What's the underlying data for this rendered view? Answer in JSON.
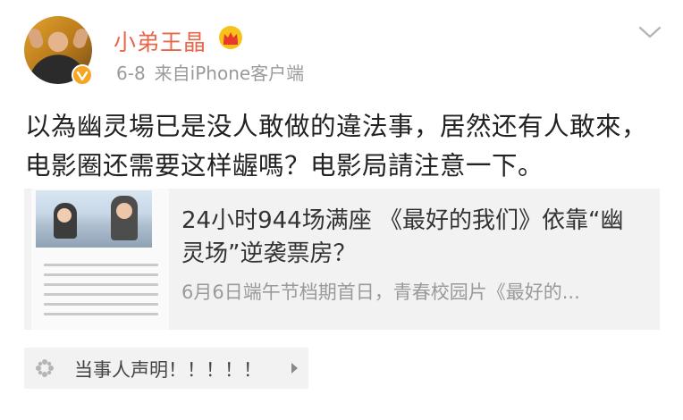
{
  "user": {
    "name": "小弟王晶",
    "date": "6-8",
    "source": "来自iPhone客户端"
  },
  "post": {
    "lines": [
      "以為幽灵場已是没人敢做的違法事，居然还有人敢來，",
      "电影圈还需要这样龌嗎？电影局請注意一下。"
    ]
  },
  "article_card": {
    "title": "24小时944场满座 《最好的我们》依靠“幽灵场”逆袭票房？",
    "description": "6月6日端午节档期首日，青春校园片《最好的..."
  },
  "topic": {
    "label": "当事人声明！！！！！"
  },
  "colors": {
    "username": "#e8664a",
    "meta": "#9a9a9a",
    "card_bg": "#f2f2f2",
    "badge": "#f5a623"
  },
  "icons": [
    "avatar",
    "verified-badge-icon",
    "crown-icon",
    "chevron-down-icon",
    "topic-pinwheel-icon",
    "arrow-right-icon"
  ]
}
